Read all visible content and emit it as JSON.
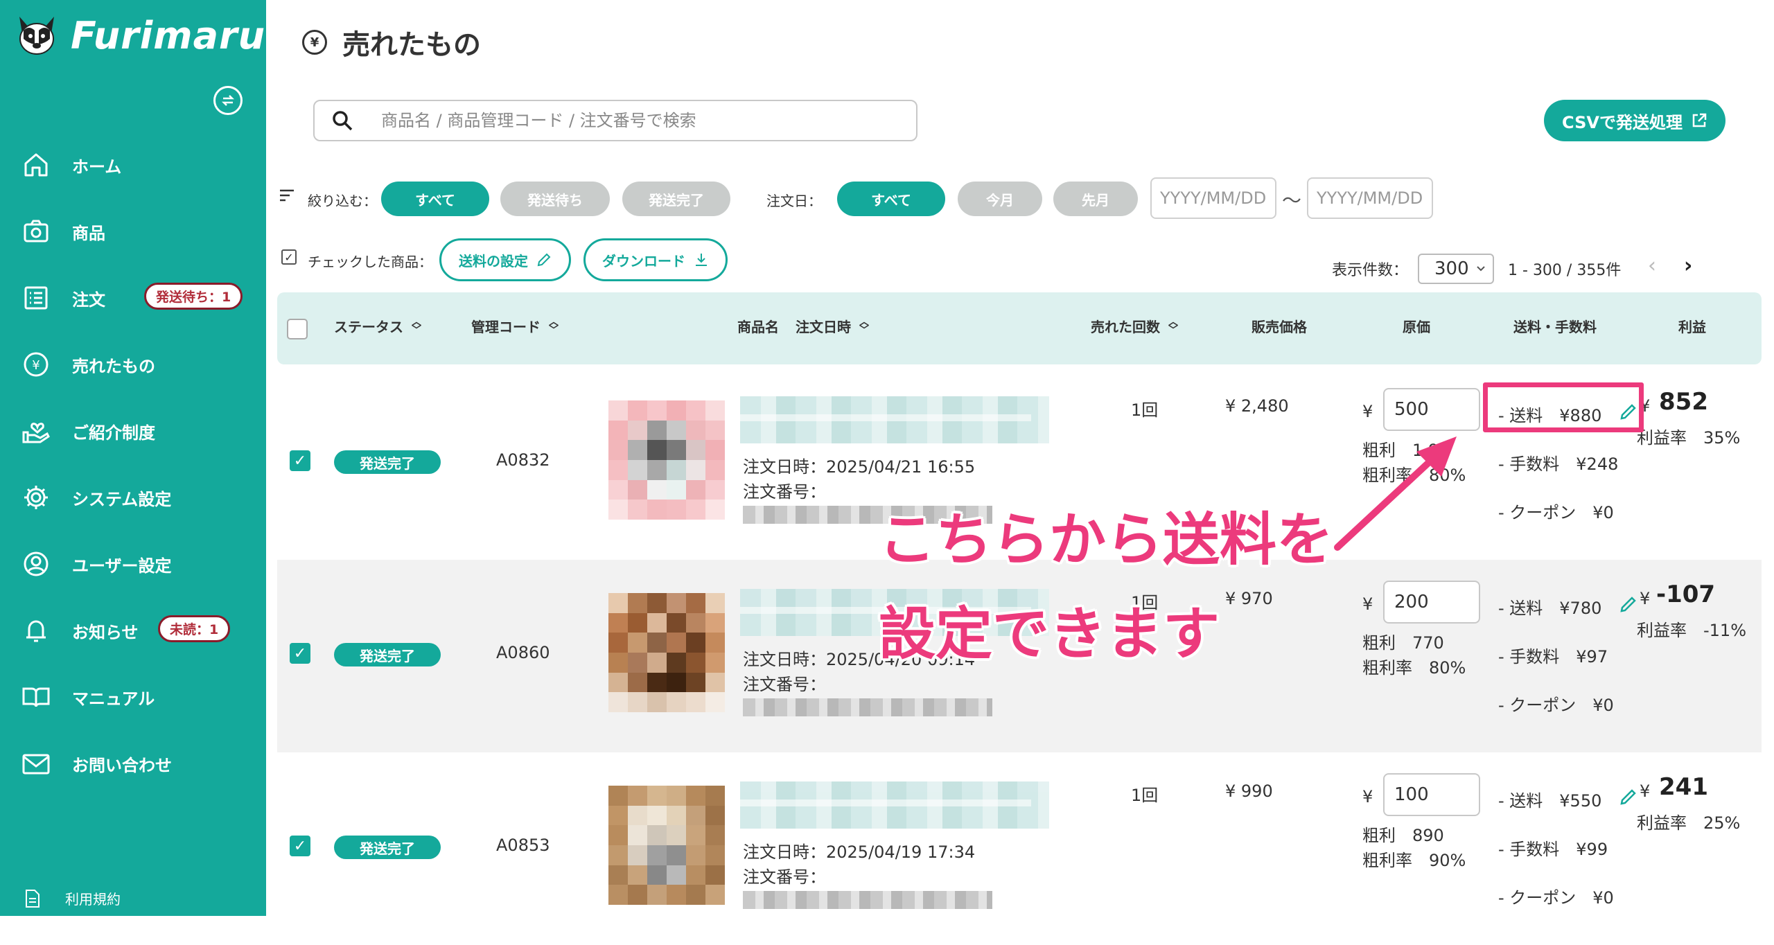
{
  "sidebar": {
    "brand": "Furimaru?",
    "items": [
      {
        "label": "ホーム",
        "icon": "home-icon"
      },
      {
        "label": "商品",
        "icon": "camera-icon"
      },
      {
        "label": "注文",
        "icon": "list-icon",
        "badge": "発送待ち：1"
      },
      {
        "label": "売れたもの",
        "icon": "yen-circle-icon"
      },
      {
        "label": "ご紹介制度",
        "icon": "heart-hand-icon"
      },
      {
        "label": "システム設定",
        "icon": "gear-icon"
      },
      {
        "label": "ユーザー設定",
        "icon": "user-circle-icon"
      },
      {
        "label": "お知らせ",
        "icon": "bell-icon",
        "badge": "未読：1"
      },
      {
        "label": "マニュアル",
        "icon": "book-icon"
      },
      {
        "label": "お問い合わせ",
        "icon": "mail-icon"
      }
    ],
    "terms": "利用規約"
  },
  "page": {
    "title": "売れたもの",
    "title_icon": "¥"
  },
  "search": {
    "placeholder": "商品名 / 商品管理コード / 注文番号で検索"
  },
  "csv_button": "CSVで発送処理",
  "filters": {
    "narrow_label": "絞り込む：",
    "status_pills": [
      "すべて",
      "発送待ち",
      "発送完了"
    ],
    "order_date_label": "注文日：",
    "date_pills": [
      "すべて",
      "今月",
      "先月"
    ],
    "date_from_placeholder": "YYYY/MM/DD",
    "date_to_placeholder": "YYYY/MM/DD",
    "tilde": "〜"
  },
  "checked_actions": {
    "label": "チェックした商品：",
    "shipping_button": "送料の設定",
    "download_button": "ダウンロード"
  },
  "pagination": {
    "per_page_label": "表示件数：",
    "per_page_value": "300",
    "range": "1 - 300 / 355件"
  },
  "table": {
    "headers": {
      "status": "ステータス",
      "code": "管理コード",
      "name": "商品名",
      "order_date": "注文日時",
      "sold_count": "売れた回数",
      "price": "販売価格",
      "cost": "原価",
      "fees": "送料・手数料",
      "profit": "利益"
    },
    "rows": [
      {
        "status": "発送完了",
        "code": "A0832",
        "order_date": "注文日時：2025/04/21 16:55",
        "order_no": "注文番号：",
        "sold_count": "1回",
        "price": "¥ 2,480",
        "cost": "500",
        "gross": "粗利　1,98",
        "gross_rate": "粗利率　80%",
        "shipping": "- 送料　¥880",
        "commission": "- 手数料　¥248",
        "coupon": "- クーポン　¥0",
        "profit": "852",
        "profit_rate": "利益率　35%"
      },
      {
        "status": "発送完了",
        "code": "A0860",
        "order_date": "注文日時：2025/04/20 09:14",
        "order_no": "注文番号：",
        "sold_count": "1回",
        "price": "¥ 970",
        "cost": "200",
        "gross": "粗利　770",
        "gross_rate": "粗利率　80%",
        "shipping": "- 送料　¥780",
        "commission": "- 手数料　¥97",
        "coupon": "- クーポン　¥0",
        "profit": "-107",
        "profit_rate": "利益率　-11%"
      },
      {
        "status": "発送完了",
        "code": "A0853",
        "order_date": "注文日時：2025/04/19 17:34",
        "order_no": "注文番号：",
        "sold_count": "1回",
        "price": "¥ 990",
        "cost": "100",
        "gross": "粗利　890",
        "gross_rate": "粗利率　90%",
        "shipping": "- 送料　¥550",
        "commission": "- 手数料　¥99",
        "coupon": "- クーポン　¥0",
        "profit": "241",
        "profit_rate": "利益率　25%"
      }
    ]
  },
  "annotation": {
    "line1": "こちらから送料を",
    "line2": "設定できます",
    "color": "#ec3a7c"
  },
  "colors": {
    "accent": "#14a99b",
    "header_bg": "#ddf1ef",
    "badge_border": "#8a1b2a"
  }
}
